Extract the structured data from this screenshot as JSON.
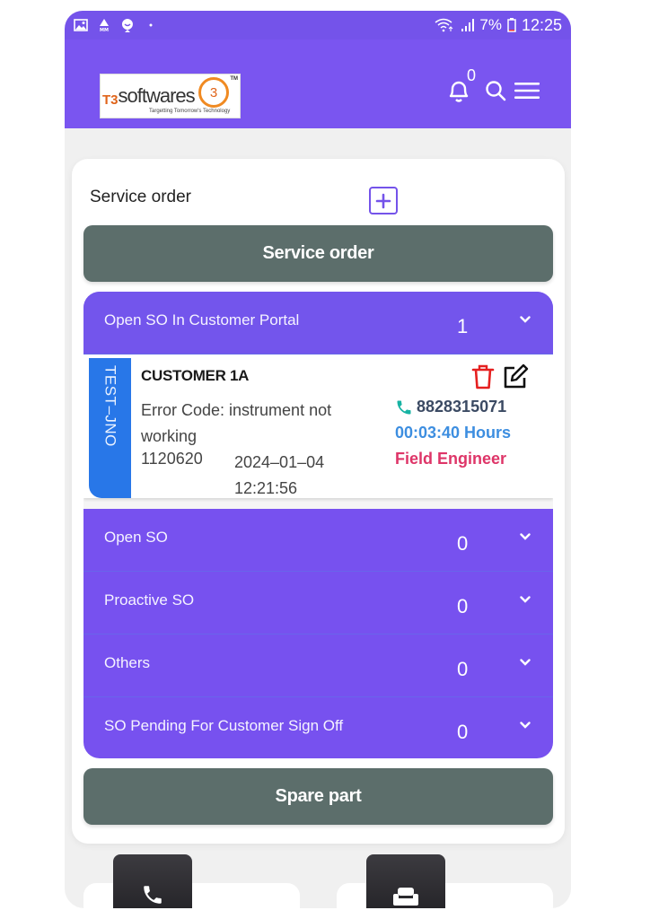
{
  "status_bar": {
    "left_icons": [
      "gallery-icon",
      "alert-mm-icon",
      "chat-icon",
      "dot-icon"
    ],
    "battery": "7%",
    "time": "12:25"
  },
  "header": {
    "logo": {
      "prefix": "T3",
      "name": "softwares",
      "tagline": "Targetting Tomorrow's Technology",
      "mark": "3",
      "tm": "TM"
    },
    "notification_count": "0"
  },
  "card": {
    "title": "Service order",
    "service_order_button": "Service order",
    "spare_part_button": "Spare part",
    "sections": [
      {
        "label": "Open SO In Customer Portal",
        "count": "1",
        "expanded": true
      },
      {
        "label": "Open SO",
        "count": "0",
        "expanded": false
      },
      {
        "label": "Proactive SO",
        "count": "0",
        "expanded": false
      },
      {
        "label": "Others",
        "count": "0",
        "expanded": false
      },
      {
        "label": "SO Pending For Customer Sign Off",
        "count": "0",
        "expanded": false
      }
    ],
    "open_item": {
      "badge": "TEST–JNO",
      "customer": "CUSTOMER 1A",
      "error": "Error Code: instrument not working",
      "number": "1120620",
      "datetime": "2024–01–04 12:21:56",
      "phone": "8828315071",
      "hours": "00:03:40 Hours",
      "role": "Field Engineer"
    }
  },
  "colors": {
    "primary": "#7453ea",
    "button_grey": "#5c6e6b",
    "badge_blue": "#2877e8",
    "phone_teal": "#17b3a3",
    "hours_blue": "#3d8ee0",
    "role_pink": "#de3568",
    "delete_red": "#e52020"
  },
  "bottom_tiles": [
    "phone-icon",
    "sofa-icon"
  ]
}
